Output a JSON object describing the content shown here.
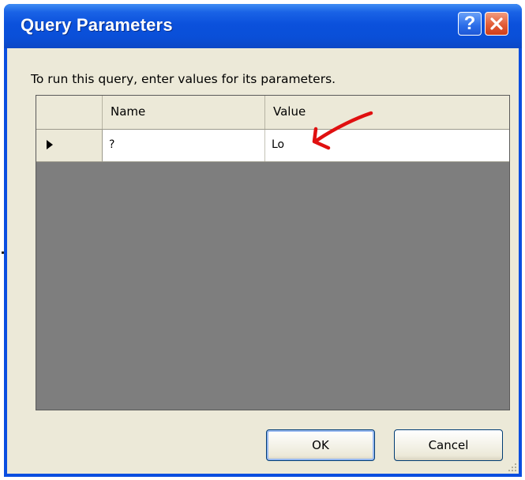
{
  "dialog": {
    "title": "Query Parameters",
    "instruction": "To run this query, enter values for its parameters."
  },
  "titlebar": {
    "help_glyph": "?",
    "close_icon": "close-icon"
  },
  "grid": {
    "columns": [
      "Name",
      "Value"
    ],
    "rows": [
      {
        "name": "?",
        "value": "Lo",
        "current": true
      }
    ]
  },
  "buttons": {
    "ok_label": "OK",
    "cancel_label": "Cancel"
  },
  "annotation": {
    "icon": "red-arrow-icon",
    "color": "#e01010"
  },
  "colors": {
    "titlebar": "#0a4fd8",
    "client": "#ece9d8",
    "grid_empty": "#7e7e7e"
  }
}
